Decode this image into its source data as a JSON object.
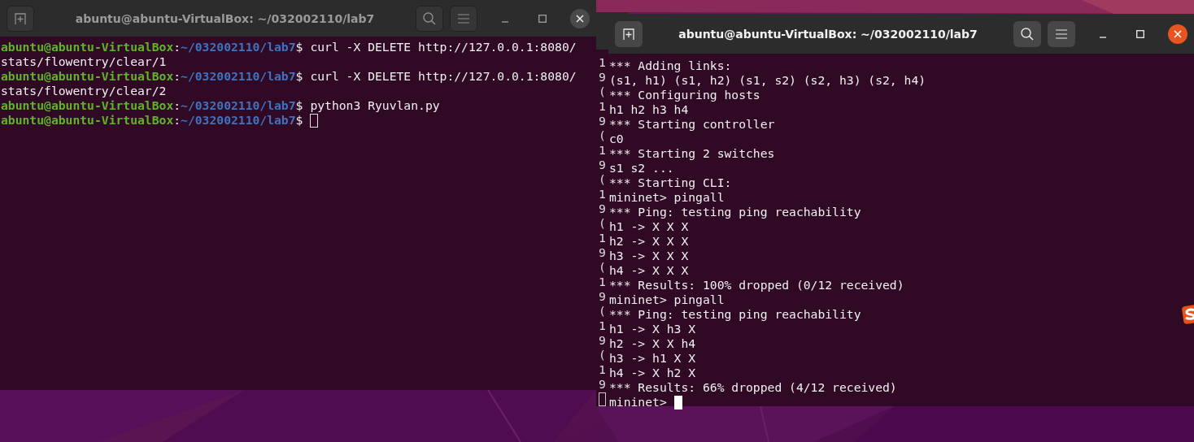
{
  "windows": [
    {
      "title": "abuntu@abuntu-VirtualBox: ~/032002110/lab7",
      "focused": false,
      "lines": [
        {
          "kind": "prompt",
          "user": "abuntu@abuntu-VirtualBox",
          "colon": ":",
          "path": "~/032002110/lab7",
          "dollar": "$",
          "command": "curl -X DELETE http://127.0.0.1:8080/",
          "cursor": false
        },
        {
          "kind": "output",
          "text": "stats/flowentry/clear/1",
          "cursor": false
        },
        {
          "kind": "prompt",
          "user": "abuntu@abuntu-VirtualBox",
          "colon": ":",
          "path": "~/032002110/lab7",
          "dollar": "$",
          "command": "curl -X DELETE http://127.0.0.1:8080/",
          "cursor": false
        },
        {
          "kind": "output",
          "text": "stats/flowentry/clear/2",
          "cursor": false
        },
        {
          "kind": "prompt",
          "user": "abuntu@abuntu-VirtualBox",
          "colon": ":",
          "path": "~/032002110/lab7",
          "dollar": "$",
          "command": "python3 Ryuvlan.py",
          "cursor": false
        },
        {
          "kind": "prompt",
          "user": "abuntu@abuntu-VirtualBox",
          "colon": ":",
          "path": "~/032002110/lab7",
          "dollar": "$",
          "cursor": true
        }
      ]
    },
    {
      "title": "abuntu@abuntu-VirtualBox: ~/032002110/lab7",
      "focused": true,
      "lines": [
        {
          "kind": "output",
          "text": "*** Adding links:",
          "cursor": false
        },
        {
          "kind": "output",
          "text": "(s1, h1) (s1, h2) (s1, s2) (s2, h3) (s2, h4)",
          "cursor": false
        },
        {
          "kind": "output",
          "text": "*** Configuring hosts",
          "cursor": false
        },
        {
          "kind": "output",
          "text": "h1 h2 h3 h4",
          "cursor": false
        },
        {
          "kind": "output",
          "text": "*** Starting controller",
          "cursor": false
        },
        {
          "kind": "output",
          "text": "c0",
          "cursor": false
        },
        {
          "kind": "output",
          "text": "*** Starting 2 switches",
          "cursor": false
        },
        {
          "kind": "output",
          "text": "s1 s2 ...",
          "cursor": false
        },
        {
          "kind": "output",
          "text": "*** Starting CLI:",
          "cursor": false
        },
        {
          "kind": "output",
          "text": "mininet> pingall",
          "cursor": false
        },
        {
          "kind": "output",
          "text": "*** Ping: testing ping reachability",
          "cursor": false
        },
        {
          "kind": "output",
          "text": "h1 -> X X X",
          "cursor": false
        },
        {
          "kind": "output",
          "text": "h2 -> X X X",
          "cursor": false
        },
        {
          "kind": "output",
          "text": "h3 -> X X X",
          "cursor": false
        },
        {
          "kind": "output",
          "text": "h4 -> X X X",
          "cursor": false
        },
        {
          "kind": "output",
          "text": "*** Results: 100% dropped (0/12 received)",
          "cursor": false
        },
        {
          "kind": "output",
          "text": "mininet> pingall",
          "cursor": false
        },
        {
          "kind": "output",
          "text": "*** Ping: testing ping reachability",
          "cursor": false
        },
        {
          "kind": "output",
          "text": "h1 -> X h3 X",
          "cursor": false
        },
        {
          "kind": "output",
          "text": "h2 -> X X h4",
          "cursor": false
        },
        {
          "kind": "output",
          "text": "h3 -> h1 X X",
          "cursor": false
        },
        {
          "kind": "output",
          "text": "h4 -> X h2 X",
          "cursor": false
        },
        {
          "kind": "output",
          "text": "*** Results: 66% dropped (4/12 received)",
          "cursor": false
        },
        {
          "kind": "output",
          "text": "mininet>",
          "cursor": true
        }
      ]
    }
  ],
  "back_window": {
    "lines": [
      {
        "text": "1",
        "cursor": false
      },
      {
        "text": "9",
        "cursor": false
      },
      {
        "text": "(",
        "cursor": false
      },
      {
        "text": "1",
        "cursor": false
      },
      {
        "text": "9",
        "cursor": false
      },
      {
        "text": "(",
        "cursor": false
      },
      {
        "text": "1",
        "cursor": false
      },
      {
        "text": "9",
        "cursor": false
      },
      {
        "text": "(",
        "cursor": false
      },
      {
        "text": "1",
        "cursor": false
      },
      {
        "text": "9",
        "cursor": false
      },
      {
        "text": "(",
        "cursor": false
      },
      {
        "text": "1",
        "cursor": false
      },
      {
        "text": "9",
        "cursor": false
      },
      {
        "text": "(",
        "cursor": false
      },
      {
        "text": "1",
        "cursor": false
      },
      {
        "text": "9",
        "cursor": false
      },
      {
        "text": "(",
        "cursor": false
      },
      {
        "text": "1",
        "cursor": false
      },
      {
        "text": "9",
        "cursor": false
      },
      {
        "text": "(",
        "cursor": false
      },
      {
        "text": "1",
        "cursor": false
      },
      {
        "text": "9",
        "cursor": false
      },
      {
        "cursor": true
      }
    ]
  }
}
